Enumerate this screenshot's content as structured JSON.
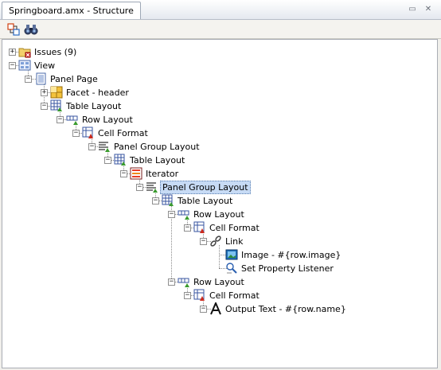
{
  "window": {
    "title": "Springboard.amx - Structure",
    "minimize_glyph": "▭",
    "close_glyph": "✕"
  },
  "toolbar": {
    "buttons": [
      {
        "icon": "freeze-view-icon"
      },
      {
        "icon": "binoculars-icon"
      }
    ]
  },
  "tree": {
    "selected_item": "Panel Group Layout",
    "nodes": [
      {
        "label": "Issues (9)",
        "icon": "folder-issues-icon",
        "expander": "+"
      },
      {
        "label": "View",
        "icon": "view-icon",
        "expander": "−"
      },
      {
        "label": "Panel Page",
        "icon": "page-icon",
        "expander": "−"
      },
      {
        "label": "Facet - header",
        "icon": "facet-icon",
        "expander": "+"
      },
      {
        "label": "Table Layout",
        "icon": "table-layout-icon",
        "expander": "−"
      },
      {
        "label": "Row Layout",
        "icon": "row-layout-icon",
        "expander": "−"
      },
      {
        "label": "Cell Format",
        "icon": "cell-format-icon",
        "expander": "−"
      },
      {
        "label": "Panel Group Layout",
        "icon": "panel-group-icon",
        "expander": "−"
      },
      {
        "label": "Table Layout",
        "icon": "table-layout-icon",
        "expander": "−"
      },
      {
        "label": "Iterator",
        "icon": "iterator-icon",
        "expander": "−"
      },
      {
        "label": "Panel Group Layout",
        "icon": "panel-group-icon",
        "expander": "−"
      },
      {
        "label": "Table Layout",
        "icon": "table-layout-icon",
        "expander": "−"
      },
      {
        "label": "Row Layout",
        "icon": "row-layout-icon",
        "expander": "−"
      },
      {
        "label": "Cell Format",
        "icon": "cell-format-icon",
        "expander": "−"
      },
      {
        "label": "Link",
        "icon": "link-icon",
        "expander": "−"
      },
      {
        "label": "Image - #{row.image}",
        "icon": "image-icon",
        "expander": ""
      },
      {
        "label": "Set Property Listener",
        "icon": "property-listener-icon",
        "expander": ""
      },
      {
        "label": "Row Layout",
        "icon": "row-layout-icon",
        "expander": "−"
      },
      {
        "label": "Cell Format",
        "icon": "cell-format-icon",
        "expander": "−"
      },
      {
        "label": "Output Text - #{row.name}",
        "icon": "output-text-icon",
        "expander": "−"
      }
    ]
  }
}
